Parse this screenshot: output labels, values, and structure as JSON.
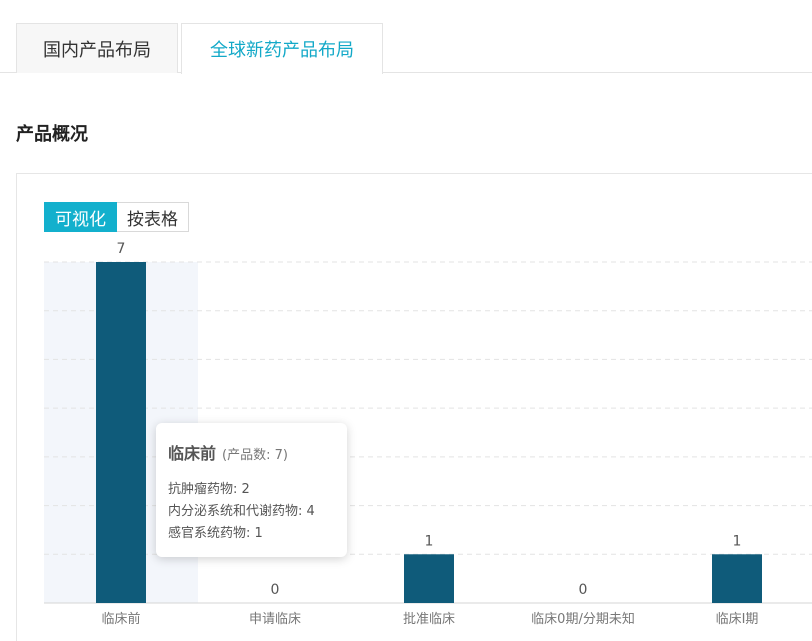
{
  "tabs": [
    {
      "label": "国内产品布局",
      "active": false
    },
    {
      "label": "全球新药产品布局",
      "active": true
    }
  ],
  "section_title": "产品概况",
  "view_toggle": {
    "visual_label": "可视化",
    "table_label": "按表格",
    "selected": "可视化"
  },
  "colors": {
    "accent": "#13b0cd",
    "bar": "#0f5b7a",
    "highlight_band": "#f3f6fb"
  },
  "chart_data": {
    "type": "bar",
    "categories": [
      "临床前",
      "申请临床",
      "批准临床",
      "临床0期/分期未知",
      "临床I期"
    ],
    "values": [
      7,
      0,
      1,
      0,
      1
    ],
    "ylim": [
      0,
      7
    ],
    "grid": true,
    "highlighted_category": "临床前"
  },
  "tooltip": {
    "category": "临床前",
    "subtitle": "(产品数: 7)",
    "rows": [
      "抗肿瘤药物: 2",
      "内分泌系统和代谢药物: 4",
      "感官系统药物: 1"
    ]
  }
}
